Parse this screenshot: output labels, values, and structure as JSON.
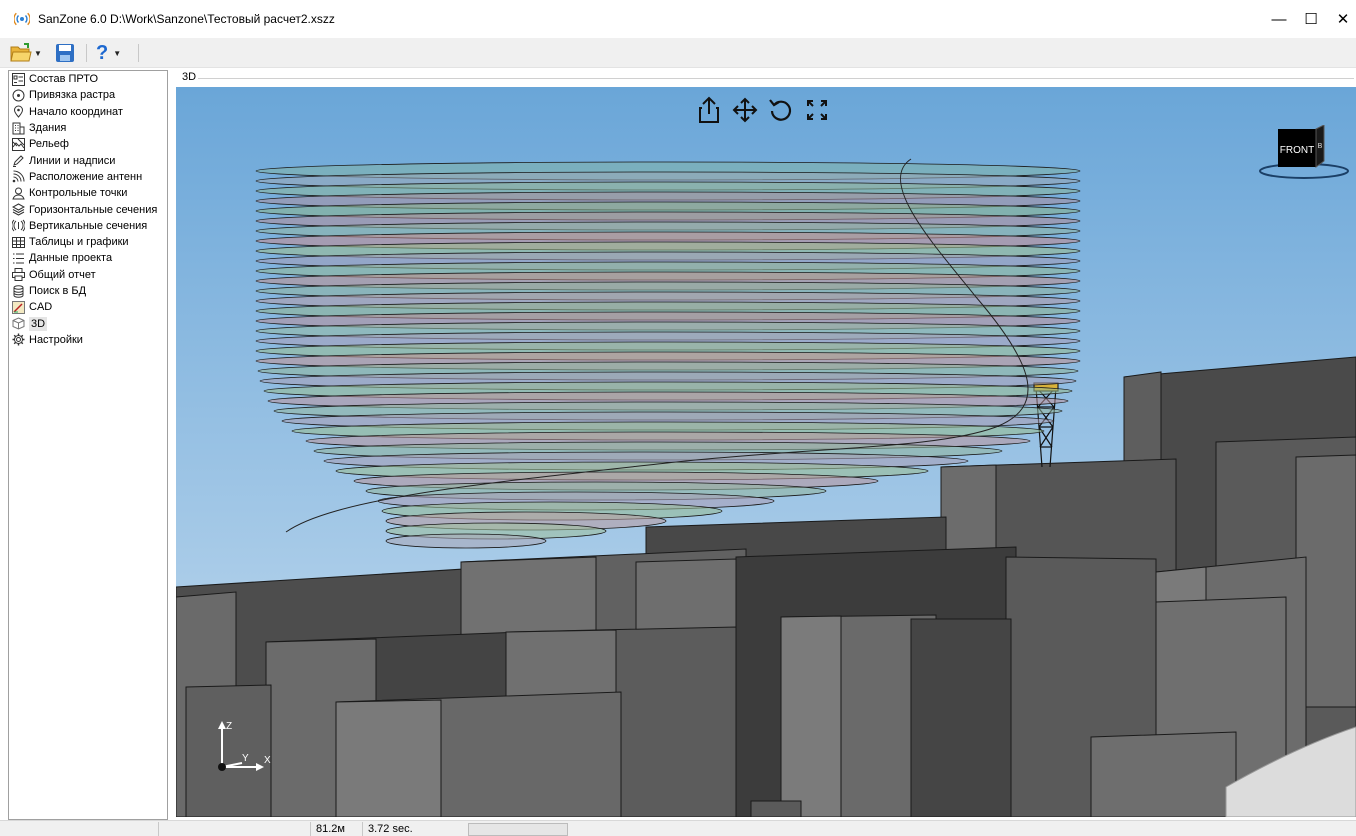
{
  "window": {
    "title": "SanZone 6.0 D:\\Work\\Sanzone\\Тестовый расчет2.xszz",
    "minimize": "—",
    "maximize": "☐",
    "close": "✕"
  },
  "toolbar": {
    "open_icon": "folder-open-icon",
    "save_icon": "floppy-disk-icon",
    "help_label": "?"
  },
  "sidebar": {
    "items": [
      {
        "label": "Состав ПРТО",
        "icon": "list-card-icon"
      },
      {
        "label": "Привязка растра",
        "icon": "crosshair-circle-icon"
      },
      {
        "label": "Начало координат",
        "icon": "map-pin-icon"
      },
      {
        "label": "Здания",
        "icon": "building-icon"
      },
      {
        "label": "Рельеф",
        "icon": "terrain-icon"
      },
      {
        "label": "Линии и надписи",
        "icon": "pen-icon"
      },
      {
        "label": "Расположение антенн",
        "icon": "antenna-signal-icon"
      },
      {
        "label": "Контрольные точки",
        "icon": "location-person-icon"
      },
      {
        "label": "Горизонтальные сечения",
        "icon": "layers-icon"
      },
      {
        "label": "Вертикальные сечения",
        "icon": "radio-waves-icon"
      },
      {
        "label": "Таблицы и графики",
        "icon": "table-icon"
      },
      {
        "label": "Данные проекта",
        "icon": "bullet-list-icon"
      },
      {
        "label": "Общий отчет",
        "icon": "printer-icon"
      },
      {
        "label": "Поиск в БД",
        "icon": "database-icon"
      },
      {
        "label": "CAD",
        "icon": "cad-drawing-icon"
      },
      {
        "label": "3D",
        "icon": "cube-icon",
        "selected": true
      },
      {
        "label": "Настройки",
        "icon": "gear-icon"
      }
    ]
  },
  "panel": {
    "title": "3D"
  },
  "viewport": {
    "navcube_face": "FRONT",
    "navcube_side": "B",
    "axis_z": "Z",
    "axis_y": "Y",
    "axis_x": "X",
    "tool_icons": [
      "share-export-icon",
      "pan-move-icon",
      "rotate-icon",
      "fullscreen-icon"
    ]
  },
  "statusbar": {
    "distance": "81.2м",
    "time": "3.72 sec."
  }
}
